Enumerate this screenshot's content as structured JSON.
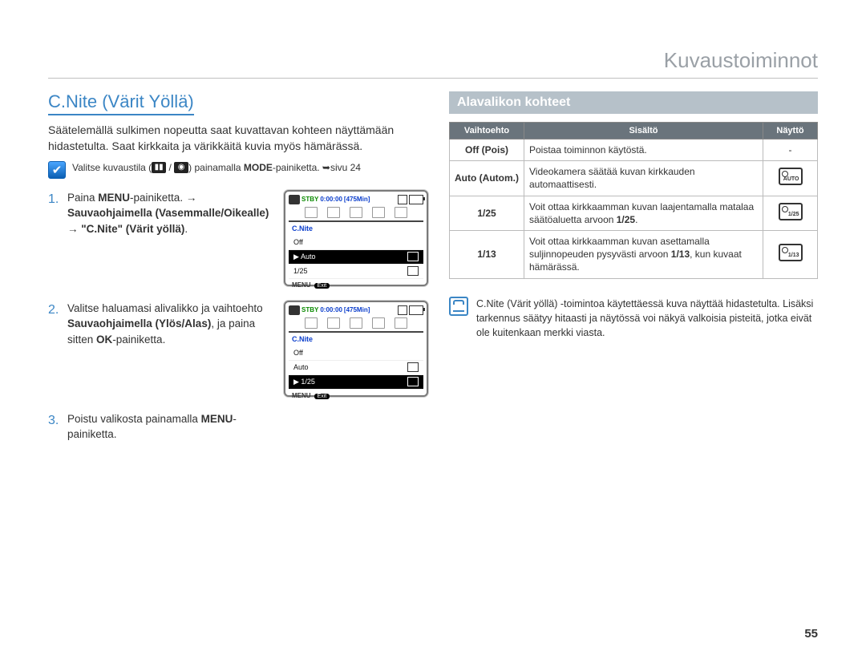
{
  "chapter": "Kuvaustoiminnot",
  "section_title": "C.Nite (Värit Yöllä)",
  "lead": "Säätelemällä sulkimen nopeutta saat kuvattavan kohteen näyttämään hidastetulta. Saat kirkkaita ja värikkäitä kuvia myös hämärässä.",
  "mode_note_a": "Valitse kuvaustila (",
  "mode_note_b": " / ",
  "mode_note_c": ") painamalla ",
  "mode_note_d": "MODE",
  "mode_note_e": "-painiketta. ➥sivu 24",
  "steps": {
    "s1_a": "Paina ",
    "s1_b": "MENU",
    "s1_c": "-painiketta. → ",
    "s1_d": "Sauvaohjaimella (Vasemmalle/Oikealle) → \"C.Nite\" (Värit yöllä)",
    "s1_e": ".",
    "s2_a": "Valitse haluamasi alivalikko ja vaihtoehto ",
    "s2_b": "Sauvaohjaimella (Ylös/Alas)",
    "s2_c": ", ja paina sitten ",
    "s2_d": "OK",
    "s2_e": "-painiketta.",
    "s3_a": "Poistu valikosta painamalla ",
    "s3_b": "MENU",
    "s3_c": "-painiketta."
  },
  "lcd": {
    "stby": "STBY",
    "time": "0:00:00",
    "remain": "[475Min]",
    "menu_label": "C.Nite",
    "off": "Off",
    "auto": "Auto",
    "v125": "1/25",
    "menu_word": "MENU",
    "exit": "Exit"
  },
  "subhead": "Alavalikon kohteet",
  "table": {
    "h1": "Vaihtoehto",
    "h2": "Sisältö",
    "h3": "Näyttö",
    "rows": [
      {
        "opt": "Off (Pois)",
        "desc": "Poistaa toiminnon käytöstä.",
        "disp": "-"
      },
      {
        "opt": "Auto (Autom.)",
        "desc": "Videokamera säätää kuvan kirkkauden automaattisesti.",
        "disp": "AUTO"
      },
      {
        "opt": "1/25",
        "desc_a": "Voit ottaa kirkkaamman kuvan laajentamalla matalaa säätöaluetta arvoon ",
        "desc_b": "1/25",
        "desc_c": ".",
        "disp": "1/25"
      },
      {
        "opt": "1/13",
        "desc_a": "Voit ottaa kirkkaamman kuvan asettamalla suljinnopeuden pysyvästi arvoon ",
        "desc_b": "1/13",
        "desc_c": ", kun kuvaat hämärässä.",
        "disp": "1/13"
      }
    ]
  },
  "info": "C.Nite (Värit yöllä) -toimintoa käytettäessä kuva näyttää hidastetulta. Lisäksi tarkennus säätyy hitaasti ja näytössä voi näkyä valkoisia pisteitä, jotka eivät ole kuitenkaan merkki viasta.",
  "page_num": "55"
}
